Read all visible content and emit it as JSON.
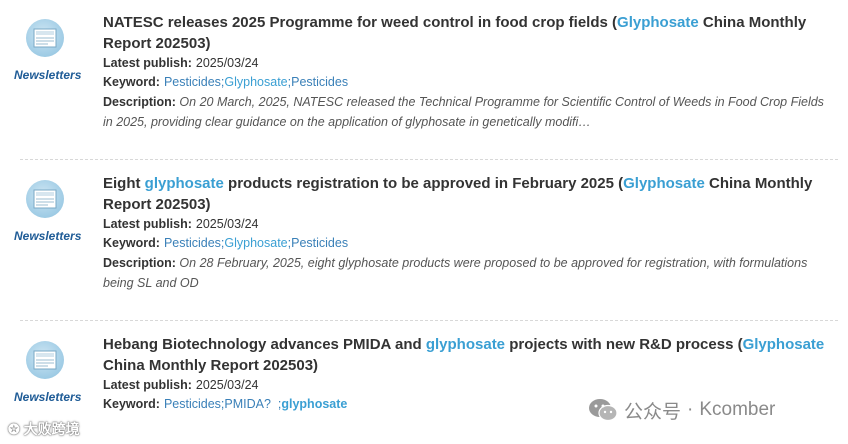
{
  "labels": {
    "latest_publish": "Latest publish:",
    "keyword": "Keyword:",
    "description": "Description:"
  },
  "entries": [
    {
      "category": "Newsletters",
      "title_parts": [
        "NATESC releases 2025 Programme for weed control in food crop fields (",
        "Glyphosate",
        " China Monthly Report 202503)"
      ],
      "date": "2025/03/24",
      "keywords": [
        "Pesticides;",
        "Glyphosate",
        ";Pesticides"
      ],
      "description": "On 20 March, 2025, NATESC released the Technical Programme for Scientific Control of Weeds in Food Crop Fields in 2025, providing clear guidance on the application of glyphosate in genetically modifi…"
    },
    {
      "category": "Newsletters",
      "title_parts": [
        "Eight ",
        "glyphosate",
        " products registration to be approved in February 2025 (",
        "Glyphosate",
        " China Monthly Report 202503)"
      ],
      "date": "2025/03/24",
      "keywords": [
        "Pesticides;",
        "Glyphosate",
        ";Pesticides"
      ],
      "description": "On 28 February, 2025, eight glyphosate products were proposed to be approved for registration, with formulations being SL and OD"
    },
    {
      "category": "Newsletters",
      "title_parts": [
        "Hebang Biotechnology advances PMIDA and ",
        "glyphosate",
        " projects with new R&D process (",
        "Glyphosate",
        " China Monthly Report 202503)"
      ],
      "date": "2025/03/24",
      "keywords": [
        "Pesticides;PMIDA?  ;",
        "glyphosate"
      ]
    }
  ],
  "watermarks": {
    "left": "大败跨境",
    "right_name": "公众号",
    "right_dot": "·",
    "right_brand": "Kcomber"
  },
  "colors": {
    "accent_link": "#3a9fd3",
    "category_label": "#1e5b96",
    "keyword_text": "#3a80b8"
  }
}
